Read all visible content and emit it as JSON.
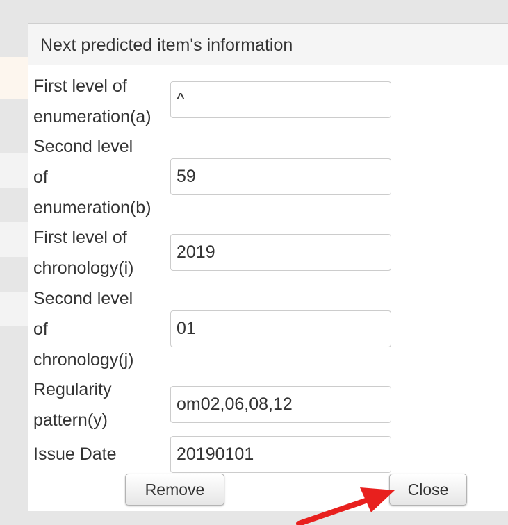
{
  "dialog": {
    "title": "Next predicted item's information",
    "fields": [
      {
        "label": "First level of\nenumeration(a)",
        "value": "^"
      },
      {
        "label": "Second level\nof\nenumeration(b)",
        "value": "59"
      },
      {
        "label": "First level of\nchronology(i)",
        "value": "2019"
      },
      {
        "label": "Second level\nof\nchronology(j)",
        "value": "01"
      },
      {
        "label": "Regularity\npattern(y)",
        "value": "om02,06,08,12"
      },
      {
        "label": "Issue Date",
        "value": "20190101"
      }
    ],
    "remove_label": "Remove",
    "close_label": "Close"
  },
  "annotation": {
    "arrow_icon": "red-arrow-icon",
    "arrow_color": "#e8201e"
  }
}
